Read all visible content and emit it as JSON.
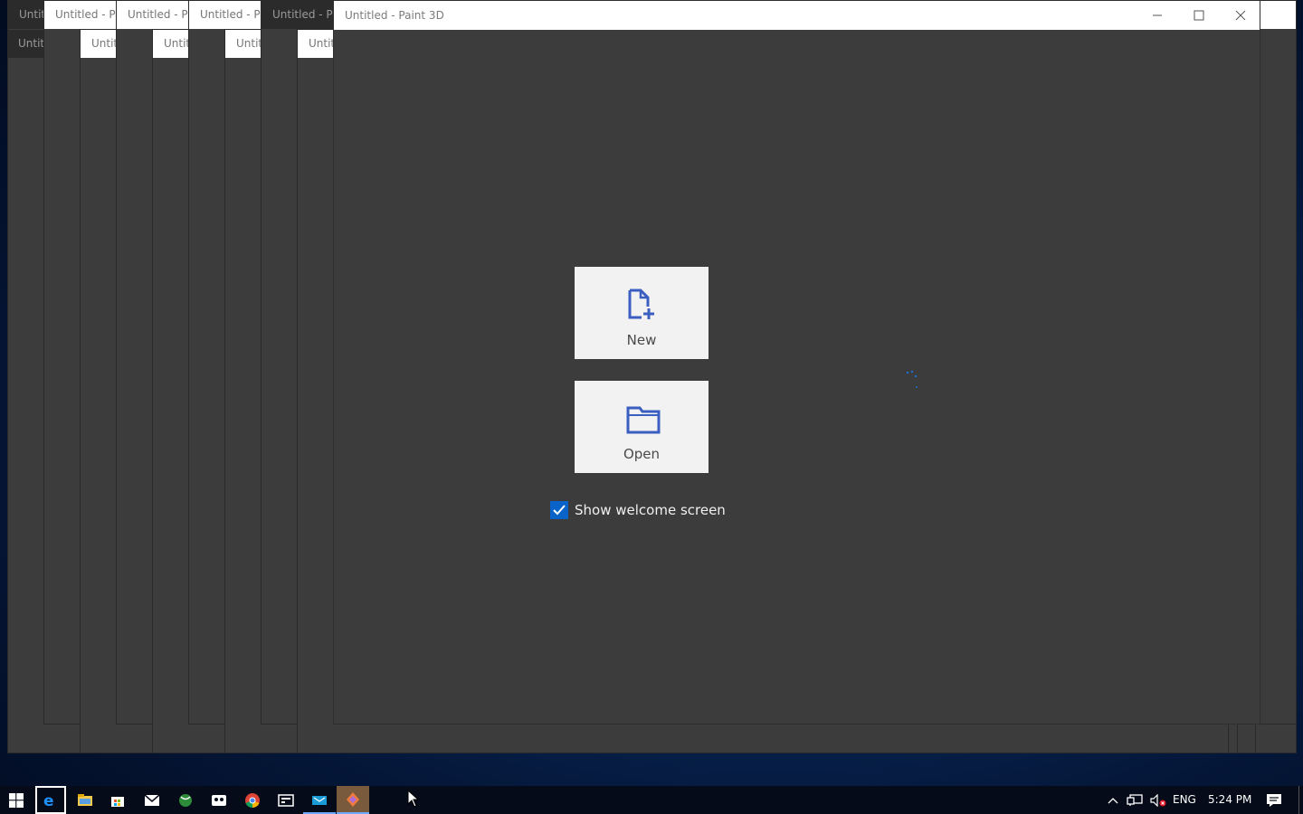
{
  "windows": {
    "back_titles": [
      "Untitl",
      "Untitled - Pai",
      "Untitled - Pai",
      "Untitled - Pa",
      "Untitled - Pa"
    ],
    "sub_titles": [
      "Untitl",
      "Untitl",
      "Untitl",
      "Untitl",
      "Untitl",
      "Untitl"
    ]
  },
  "main": {
    "title": "Untitled - Paint 3D",
    "new_label": "New",
    "open_label": "Open",
    "show_welcome_label": "Show welcome screen",
    "show_welcome_checked": true
  },
  "taskbar": {
    "icons": [
      "windows-start-icon",
      "edge-icon",
      "file-explorer-icon",
      "store-icon",
      "mail-icon",
      "xbox-icon",
      "photos-icon",
      "chrome-icon",
      "calculator-icon",
      "mail-app-icon",
      "paint-3d-icon"
    ],
    "language": "ENG",
    "time": "5:24 PM"
  },
  "colors": {
    "accent": "#0a63c9",
    "window_bg": "#3c3c3c",
    "card_bg": "#f2f2f2"
  }
}
